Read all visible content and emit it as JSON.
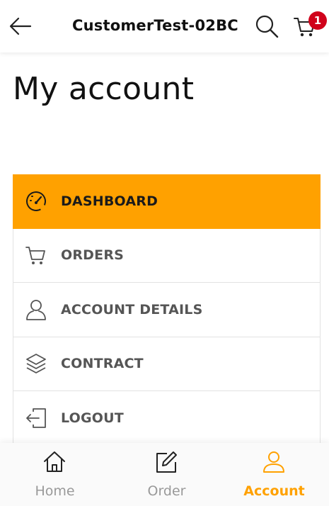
{
  "header": {
    "title": "CustomerTest-02BC",
    "back_icon": "arrow-left-icon",
    "search_icon": "search-icon",
    "cart_icon": "cart-icon",
    "cart_count": "1",
    "badge_color": "#d0021b"
  },
  "page": {
    "title": "My account"
  },
  "menu": {
    "accent_color": "#ffa100",
    "items": [
      {
        "label": "DASHBOARD",
        "icon": "speedometer-icon",
        "active": true
      },
      {
        "label": "ORDERS",
        "icon": "cart-icon",
        "active": false
      },
      {
        "label": "ACCOUNT DETAILS",
        "icon": "user-icon",
        "active": false
      },
      {
        "label": "CONTRACT",
        "icon": "layers-icon",
        "active": false
      },
      {
        "label": "LOGOUT",
        "icon": "logout-icon",
        "active": false
      }
    ]
  },
  "bottom_nav": {
    "items": [
      {
        "label": "Home",
        "icon": "home-icon",
        "active": false
      },
      {
        "label": "Order",
        "icon": "edit-icon",
        "active": false
      },
      {
        "label": "Account",
        "icon": "user-icon",
        "active": true
      }
    ]
  }
}
